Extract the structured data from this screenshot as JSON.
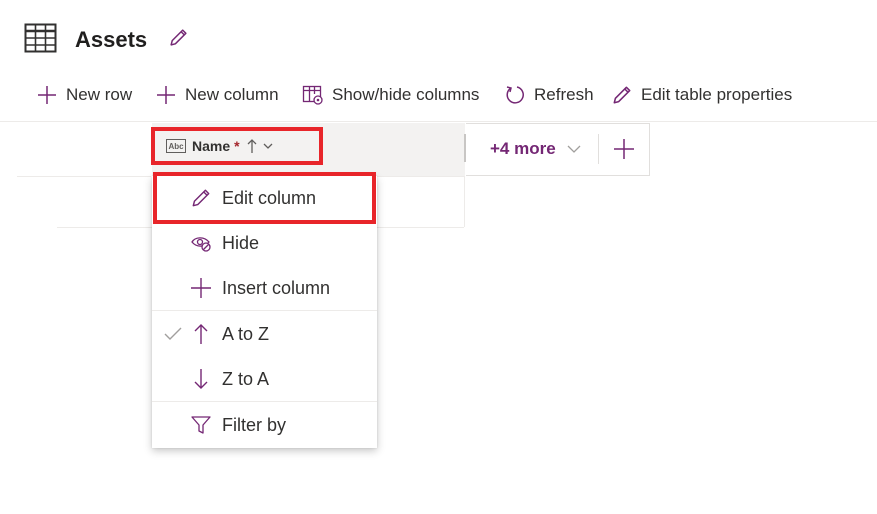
{
  "header": {
    "title": "Assets"
  },
  "toolbar": {
    "new_row": "New row",
    "new_column": "New column",
    "show_hide_columns": "Show/hide columns",
    "refresh": "Refresh",
    "edit_table_properties": "Edit table properties"
  },
  "grid": {
    "column_name": "Name",
    "required_marker": "*",
    "more_columns": "+4 more"
  },
  "menu": {
    "items": [
      {
        "label": "Edit column",
        "icon": "pencil-icon"
      },
      {
        "label": "Hide",
        "icon": "eye-hide-icon"
      },
      {
        "label": "Insert column",
        "icon": "plus-icon"
      },
      {
        "label": "A to Z",
        "icon": "arrow-up-icon",
        "checked": true
      },
      {
        "label": "Z to A",
        "icon": "arrow-down-icon"
      },
      {
        "label": "Filter by",
        "icon": "filter-icon"
      }
    ]
  },
  "colors": {
    "accent": "#742774",
    "highlight": "#e8252a"
  }
}
